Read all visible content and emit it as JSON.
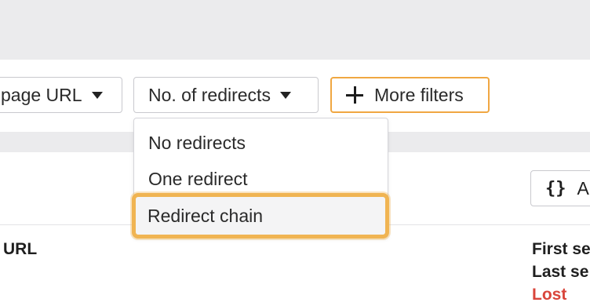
{
  "filters": {
    "page_url_label": "page URL",
    "redirects_label": "No. of redirects",
    "more_filters_label": "More filters"
  },
  "redirects_dropdown": {
    "options": [
      "No redirects",
      "One redirect",
      "Redirect chain"
    ],
    "highlighted": "Redirect chain"
  },
  "toolbar": {
    "api_label": "A",
    "api_icon": "braces-icon"
  },
  "table": {
    "url_header": "URL",
    "first_seen": "First se",
    "last_seen": "Last se",
    "lost": "Lost"
  },
  "colors": {
    "accent_orange": "#f0a742",
    "lost_red": "#d9453b"
  }
}
